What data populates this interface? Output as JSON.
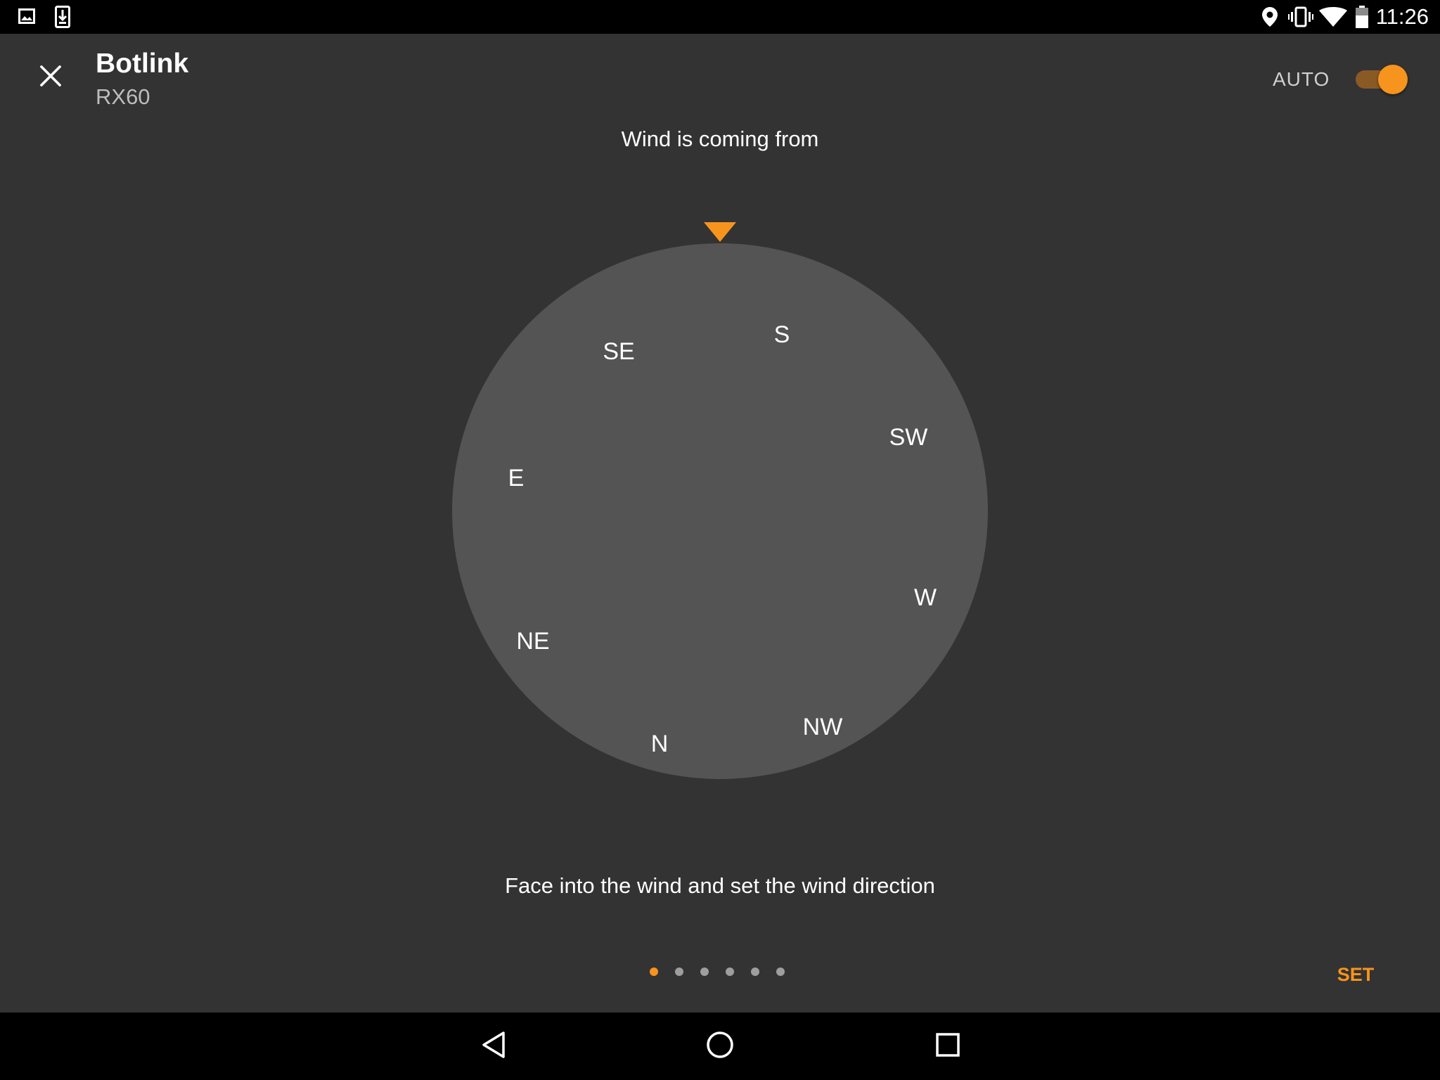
{
  "status_bar": {
    "time": "11:26",
    "left_icons": [
      "image-icon",
      "download-icon"
    ],
    "right_icons": [
      "location-icon",
      "vibrate-icon",
      "wifi-icon",
      "battery-icon"
    ]
  },
  "header": {
    "title": "Botlink",
    "subtitle": "RX60",
    "close_icon": "close-icon",
    "auto_label": "AUTO",
    "auto_enabled": true
  },
  "wind": {
    "prompt": "Wind is coming from",
    "compass_labels": {
      "S": "S",
      "SE": "SE",
      "E": "E",
      "NE": "NE",
      "N": "N",
      "NW": "NW",
      "W": "W",
      "SW": "SW"
    },
    "instruction": "Face into the wind and set the wind direction"
  },
  "pager": {
    "total": 6,
    "active_index": 0
  },
  "actions": {
    "set_label": "SET"
  },
  "nav_bar": {
    "icons": [
      "back-icon",
      "home-icon",
      "recents-icon"
    ]
  },
  "colors": {
    "accent": "#f7941d",
    "background": "#333333",
    "dial": "#545454",
    "bars": "#000000"
  }
}
